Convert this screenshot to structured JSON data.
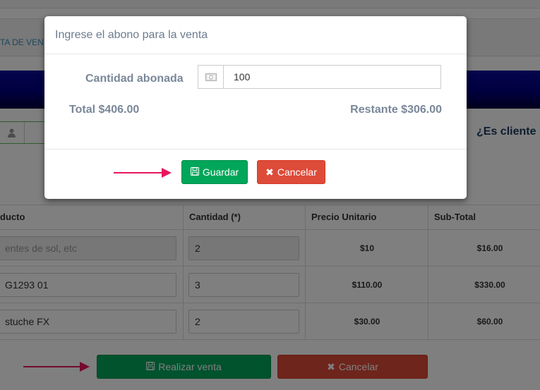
{
  "background": {
    "tab_label": "TA DE VEN",
    "user_icon": "user-icon",
    "question": "¿Es cliente r",
    "table": {
      "headers": [
        "ducto",
        "Cantidad (*)",
        "Precio Unitario",
        "Sub-Total"
      ],
      "rows": [
        {
          "product": "entes de sol, etc",
          "qty": "2",
          "price": "$10",
          "subtotal": "$16.00"
        },
        {
          "product": "G1293 01",
          "qty": "3",
          "price": "$110.00",
          "subtotal": "$330.00"
        },
        {
          "product": "stuche FX",
          "qty": "2",
          "price": "$30.00",
          "subtotal": "$60.00"
        }
      ]
    },
    "buttons": {
      "realizar_venta": "Realizar venta",
      "cancelar": "Cancelar"
    }
  },
  "modal": {
    "title": "Ingrese el abono para la venta",
    "cantidad_label": "Cantidad abonada",
    "cantidad_value": "100",
    "money_icon": "money-icon",
    "total": "Total $406.00",
    "restante": "Restante $306.00",
    "guardar": "Guardar",
    "cancelar": "Cancelar"
  },
  "colors": {
    "success": "#00a65a",
    "danger": "#dd4b39",
    "arrow": "#e8175d",
    "banner": "#000080"
  }
}
